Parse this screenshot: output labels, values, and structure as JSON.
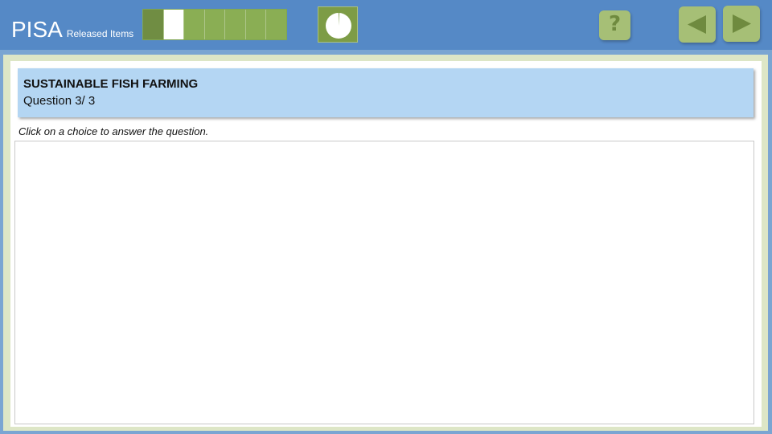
{
  "header": {
    "title": "PISA",
    "subtitle": "Released Items",
    "progress": {
      "total_segments": 7,
      "current_segment": 2,
      "completed_segments": 1
    },
    "timer": {
      "elapsed_fraction": 0.01
    },
    "help": {
      "icon": "question-mark-icon",
      "glyph": "?"
    },
    "prev": {
      "icon": "triangle-left-icon"
    },
    "next": {
      "icon": "triangle-right-icon"
    }
  },
  "question": {
    "unit_title": "SUSTAINABLE FISH FARMING",
    "number_label": "Question 3/ 3",
    "instruction": "Click on a choice to answer the question."
  },
  "colors": {
    "header_bg": "#5589c6",
    "progress_fill": "#8aae54",
    "progress_done": "#708d43",
    "button_bg": "#a6bf76",
    "button_glyph": "#6f8a3f",
    "question_bg": "#b4d6f3",
    "frame_bg": "#dde6c6"
  }
}
